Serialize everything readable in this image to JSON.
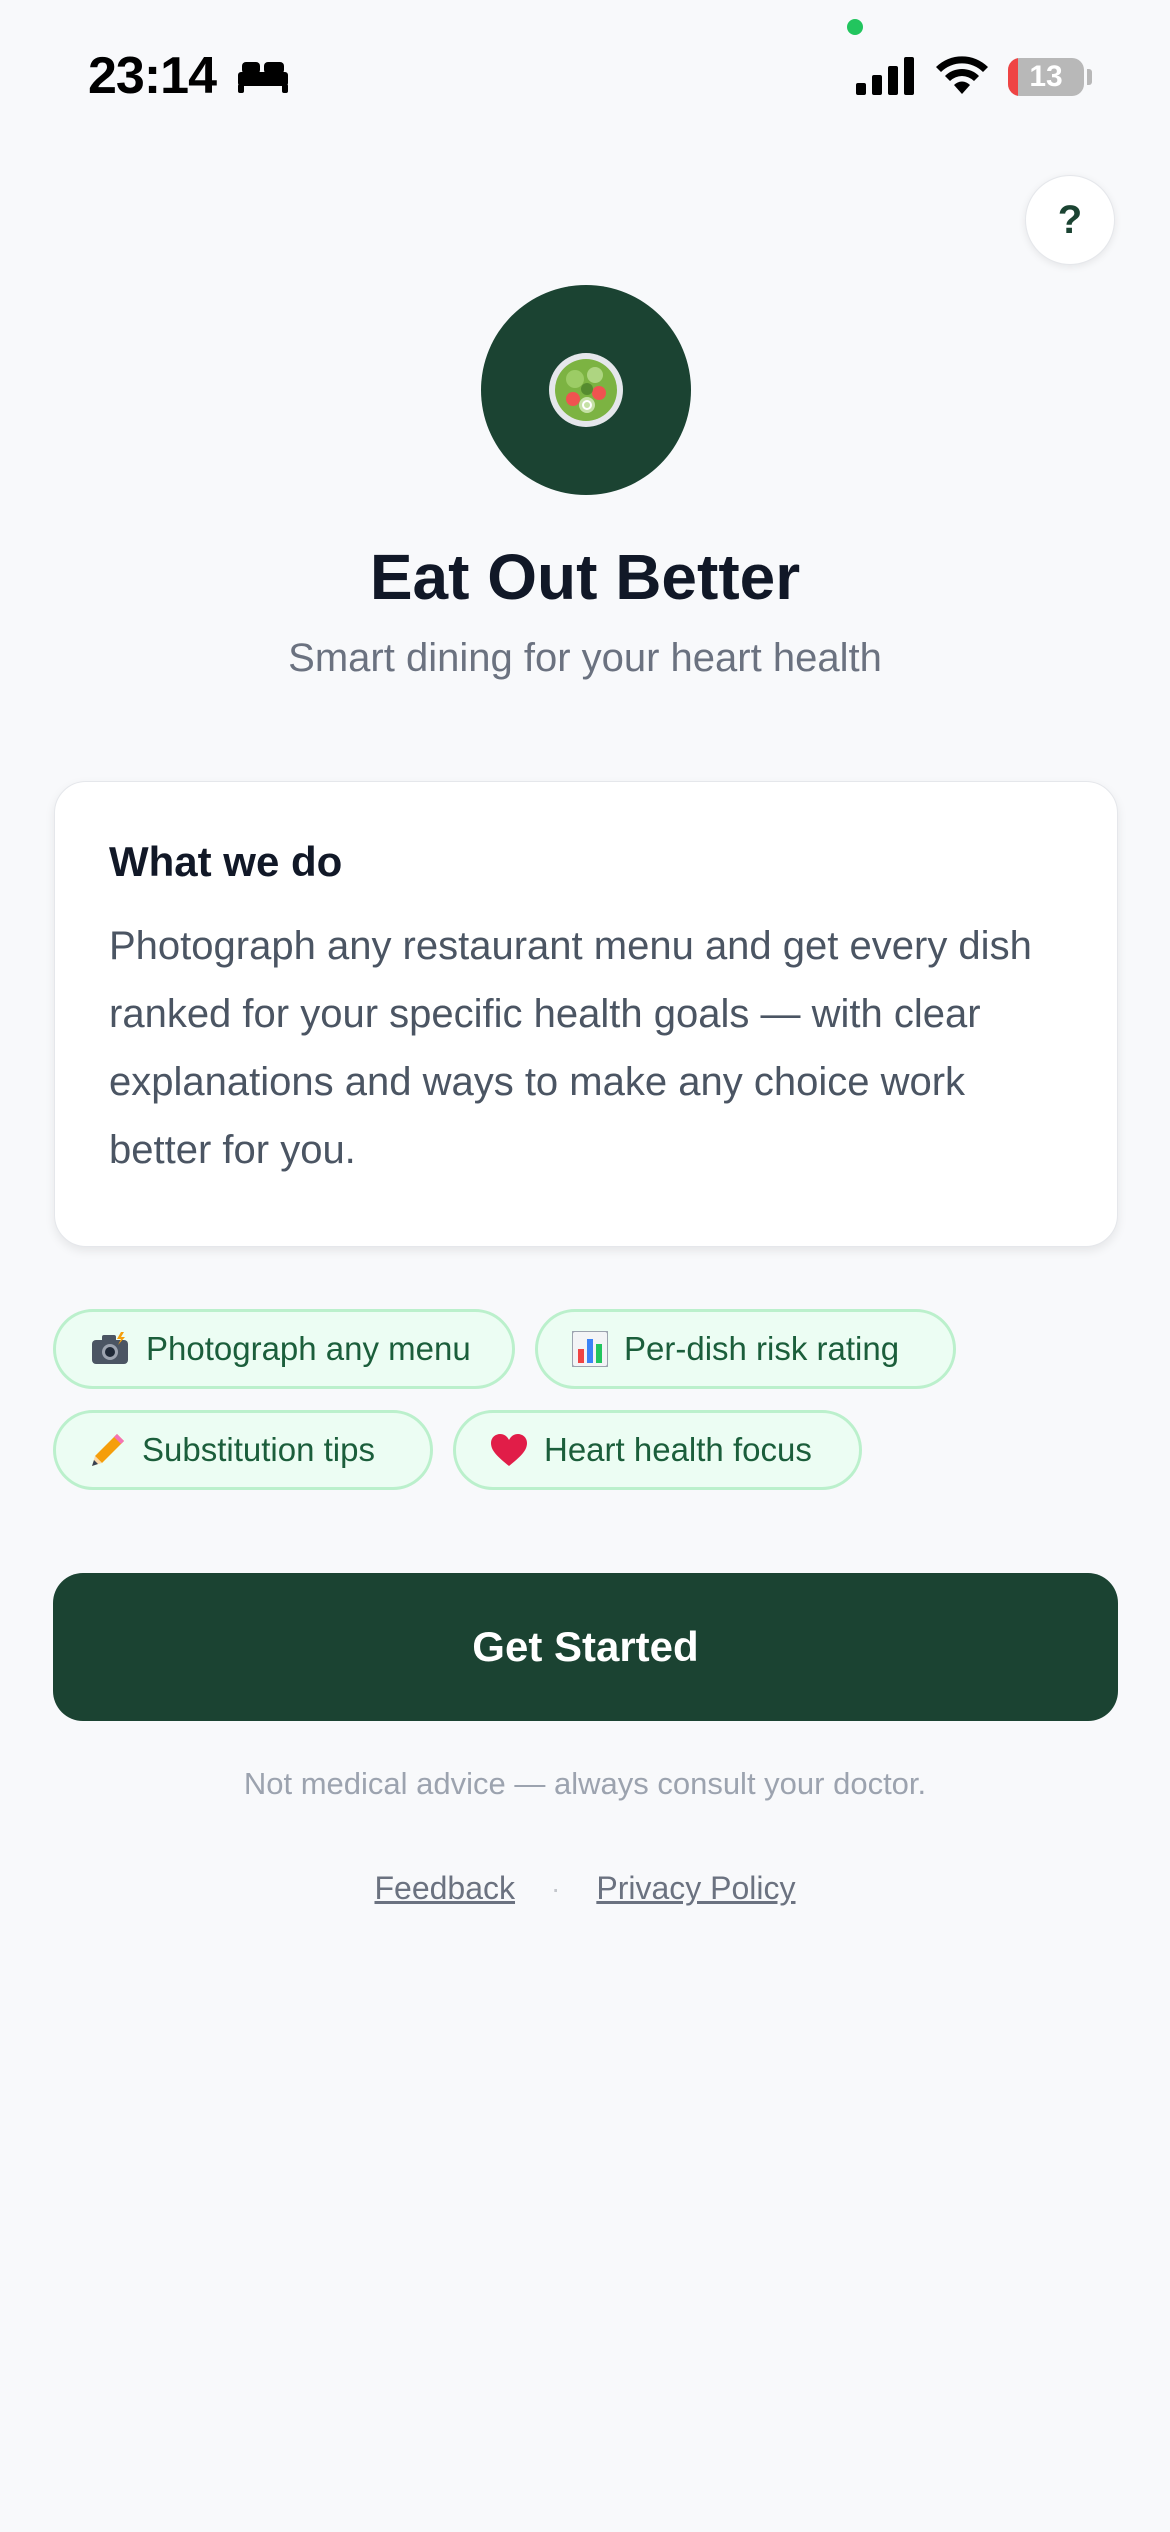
{
  "status_bar": {
    "time": "23:14",
    "battery_level": "13",
    "battery_fraction": 0.13,
    "icons": [
      "bed-icon",
      "signal-icon",
      "wifi-icon",
      "battery-icon"
    ]
  },
  "header": {
    "help_label": "?"
  },
  "hero": {
    "logo_icon": "salad-icon",
    "title": "Eat Out Better",
    "subtitle": "Smart dining for your heart health"
  },
  "card": {
    "title": "What we do",
    "body": "Photograph any restaurant menu and get every dish ranked for your specific health goals — with clear explanations and ways to make any choice work better for you."
  },
  "features": [
    {
      "icon": "camera-flash-icon",
      "label": "Photograph any menu"
    },
    {
      "icon": "bar-chart-icon",
      "label": "Per-dish risk rating"
    },
    {
      "icon": "pencil-icon",
      "label": "Substitution tips"
    },
    {
      "icon": "heart-icon",
      "label": "Heart health focus"
    }
  ],
  "cta": {
    "label": "Get Started"
  },
  "disclaimer": "Not medical advice — always consult your doctor.",
  "footer": {
    "feedback_label": "Feedback",
    "separator": "·",
    "privacy_label": "Privacy Policy"
  },
  "colors": {
    "brand": "#1b4332",
    "background": "#f8f9fb",
    "chip_bg": "#ecfdf3",
    "chip_border": "#bbf0cc",
    "chip_text": "#1b5e3b",
    "battery_low": "#ef4444"
  }
}
